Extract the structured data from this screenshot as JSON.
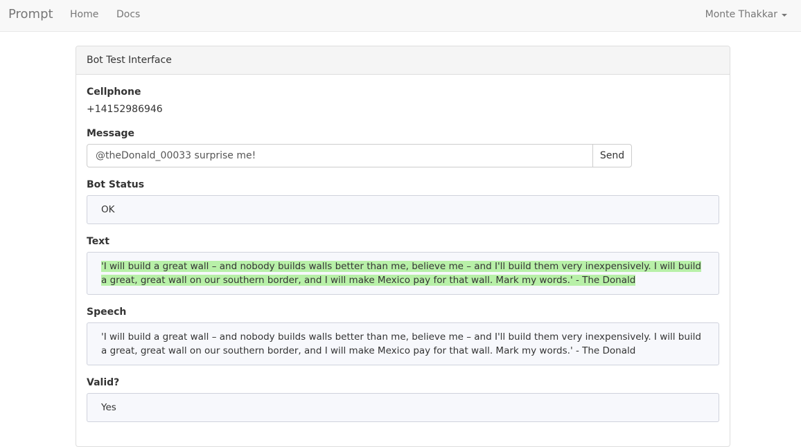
{
  "navbar": {
    "brand": "Prompt",
    "links": [
      "Home",
      "Docs"
    ],
    "user": "Monte Thakkar"
  },
  "panel": {
    "heading": "Bot Test Interface",
    "cellphone": {
      "label": "Cellphone",
      "value": "+14152986946"
    },
    "message": {
      "label": "Message",
      "value": "@theDonald_00033 surprise me!",
      "send_label": "Send"
    },
    "bot_status": {
      "label": "Bot Status",
      "value": "OK"
    },
    "text": {
      "label": "Text",
      "value": "'I will build a great wall – and nobody builds walls better than me, believe me – and I'll build them very inexpensively. I will build a great, great wall on our southern border, and I will make Mexico pay for that wall. Mark my words.' - The Donald"
    },
    "speech": {
      "label": "Speech",
      "value": "'I will build a great wall – and nobody builds walls better than me, believe me – and I'll build them very inexpensively. I will build a great, great wall on our southern border, and I will make Mexico pay for that wall. Mark my words.' - The Donald"
    },
    "valid": {
      "label": "Valid?",
      "value": "Yes"
    }
  },
  "colors": {
    "navbar_bg": "#f8f8f8",
    "highlight": "#b8f0a8",
    "box_bg": "#f7f8fc"
  }
}
